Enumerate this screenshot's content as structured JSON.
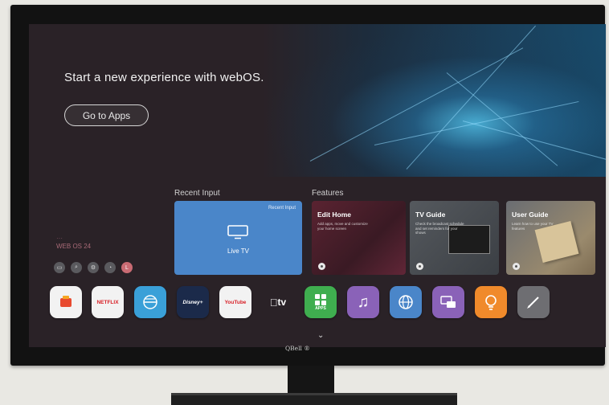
{
  "hero": {
    "title": "Start a new experience with webOS.",
    "button_label": "Go to Apps"
  },
  "sections": {
    "recent_input": "Recent Input",
    "features": "Features"
  },
  "recent_card": {
    "tag": "Recent Input",
    "label": "Live TV"
  },
  "feature_cards": [
    {
      "title": "Edit Home",
      "description": "Add apps, move and customize your home screen"
    },
    {
      "title": "TV Guide",
      "description": "Check the broadcast schedule and set reminders for your shows"
    },
    {
      "title": "User Guide",
      "description": "Learn how to use your TV features"
    }
  ],
  "status": {
    "line1": "···",
    "line2": "WEB OS 24"
  },
  "quick_icons": [
    {
      "icon": "input-icon",
      "glyph": "▭"
    },
    {
      "icon": "search-icon",
      "glyph": "⌕"
    },
    {
      "icon": "settings-icon",
      "glyph": "⚙"
    },
    {
      "icon": "notification-icon",
      "glyph": "◔"
    },
    {
      "icon": "user-icon",
      "glyph": "L"
    }
  ],
  "apps": [
    {
      "name": "lg-channels",
      "label": "",
      "bg": "#f2f2f2",
      "fg": "#e84a2f"
    },
    {
      "name": "netflix",
      "label": "NETFLIX",
      "bg": "#f2f2f2",
      "fg": "#d81f26"
    },
    {
      "name": "live-tv",
      "label": "",
      "bg": "#3aa0d8",
      "fg": "#ffffff"
    },
    {
      "name": "disney-plus",
      "label": "Disney+",
      "bg": "#1b2a4a",
      "fg": "#ffffff"
    },
    {
      "name": "youtube",
      "label": "YouTube",
      "bg": "#f2f2f2",
      "fg": "#d81f26"
    },
    {
      "name": "apple-tv",
      "label": "tv",
      "bg": "#2a2227",
      "fg": "#ffffff"
    },
    {
      "name": "apps",
      "label": "APPS",
      "bg": "#3fae4f",
      "fg": "#ffffff"
    },
    {
      "name": "music",
      "label": "♫",
      "bg": "#8a62b8",
      "fg": "#ffffff"
    },
    {
      "name": "web-browser",
      "label": "",
      "bg": "#4a86c9",
      "fg": "#ffffff"
    },
    {
      "name": "screen-share",
      "label": "",
      "bg": "#8a62b8",
      "fg": "#ffffff"
    },
    {
      "name": "tips",
      "label": "",
      "bg": "#f08a2b",
      "fg": "#ffffff"
    },
    {
      "name": "edit",
      "label": "",
      "bg": "#6e6e72",
      "fg": "#ffffff"
    }
  ],
  "brand": "QBell ®"
}
